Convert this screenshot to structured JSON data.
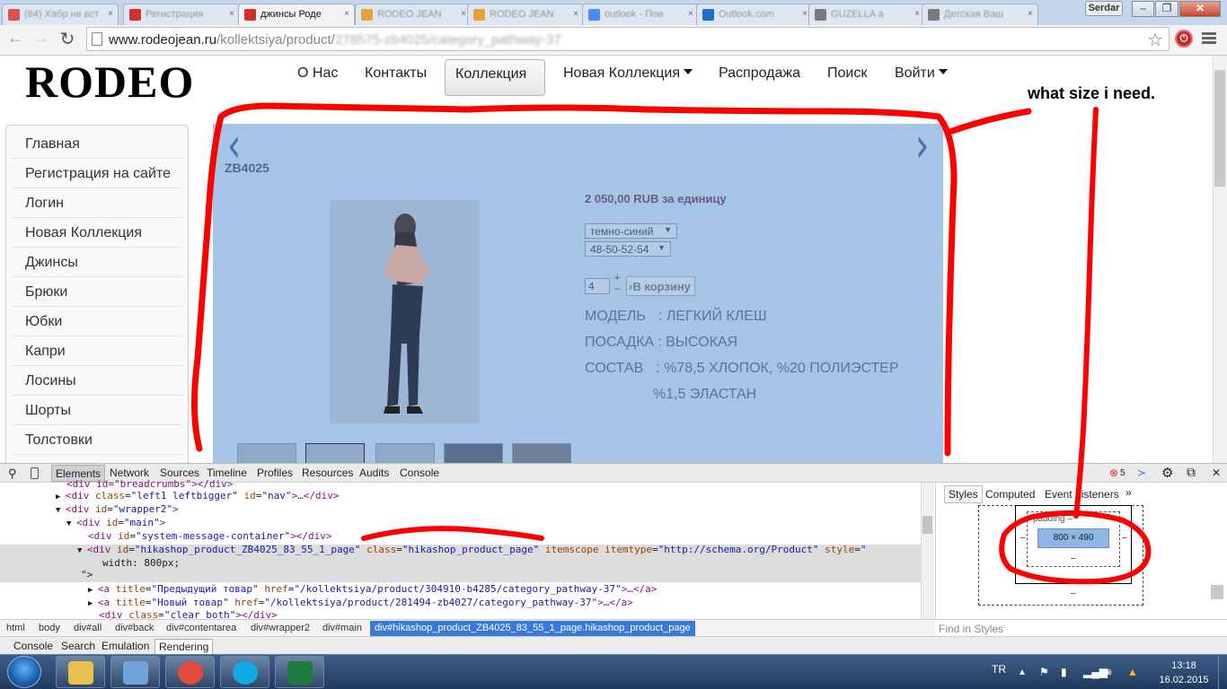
{
  "browser": {
    "tabs": [
      {
        "label": "(84) Хабр не вст",
        "favicon_color": "#d9534f",
        "active": false
      },
      {
        "label": "Регистрация",
        "favicon_color": "#d32f2f",
        "active": false
      },
      {
        "label": "джинсы Роде",
        "favicon_color": "#d32f2f",
        "active": true
      },
      {
        "label": "RODEO JEAN",
        "favicon_color": "#e5a23c",
        "active": false
      },
      {
        "label": "RODEO JEAN",
        "favicon_color": "#e5a23c",
        "active": false
      },
      {
        "label": "outlook - Пои",
        "favicon_color": "#4a8af4",
        "active": false
      },
      {
        "label": "Outlook.com",
        "favicon_color": "#1d6ec5",
        "active": false
      },
      {
        "label": "GUZELLA a",
        "favicon_color": "#7a7a7a",
        "active": false
      },
      {
        "label": "Детская Ваш",
        "favicon_color": "#7a7a7a",
        "active": false
      }
    ],
    "user_badge": "Serdar",
    "url_domain": "www.rodeojean.ru",
    "url_path": "/kollektsiya/product/",
    "url_blurred": "278575-zb4025/category_pathway-37"
  },
  "site": {
    "logo": "RODEO",
    "nav": {
      "about": "О Нас",
      "contacts": "Контакты",
      "collection": "Коллекция",
      "new_collection": "Новая Коллекция",
      "sale": "Распродажа",
      "search": "Поиск",
      "login": "Войти"
    },
    "sidebar": [
      "Главная",
      "Регистрация на сайте",
      "Логин",
      "Новая Коллекция",
      "Джинсы",
      "Брюки",
      "Юбки",
      "Капри",
      "Лосины",
      "Шорты",
      "Толстовки"
    ]
  },
  "product": {
    "code": "ZB4025",
    "price": "2 050,00 RUB за единицу",
    "color_select": "темно-синий",
    "size_select": "48-50-52-54",
    "quantity": "4",
    "qty_plus": "+",
    "qty_minus": "–",
    "add_to_cart": "›В корзину",
    "model_label": "МОДЕЛЬ",
    "model_value": ": ЛЕГКИЙ КЛЕШ",
    "fit_label": "ПОСАДКА",
    "fit_value": ": ВЫСОКАЯ",
    "composition_label": "СОСТАВ",
    "composition_value": ": %78,5 ХЛОПОК, %20 ПОЛИЭСТЕР",
    "composition_value2": "%1,5 ЭЛАСТАН",
    "overlay_color": "#a6c4e6"
  },
  "devtools": {
    "tabs": [
      "Elements",
      "Network",
      "Sources",
      "Timeline",
      "Profiles",
      "Resources",
      "Audits",
      "Console"
    ],
    "error_count": "5",
    "dom_lines": [
      {
        "text_tag": "<div id=\"breadcrumbs\"></div>"
      },
      {
        "tag1": "<div ",
        "attr1": "class",
        "val1": "\"left1 leftbigger\"",
        "attr2": "id",
        "val2": "\"nav\"",
        "tail": ">…</div>"
      },
      {
        "tag1": "<div ",
        "attr1": "id",
        "val1": "\"wrapper2\"",
        "tail": ">"
      },
      {
        "tag1": "<div ",
        "attr1": "id",
        "val1": "\"main\"",
        "tail": ">"
      },
      {
        "tag1": "<div ",
        "attr1": "id",
        "val1": "\"system-message-container\"",
        "tail": "></div>"
      },
      {
        "tag1": "<div ",
        "attr1": "id",
        "val1": "\"hikashop_product_ZB4025_83_55_1_page\"",
        "attr2": "class",
        "val2": "\"hikashop_product_page\"",
        "attr3": "itemscope itemtype",
        "val3": "\"http://schema.org/Product\"",
        "attr4": "style",
        "val4": "\""
      },
      {
        "cont": "width: 800px;"
      },
      {
        "cont": "\">"
      },
      {
        "tag1": "<a ",
        "attr1": "title",
        "val1": "\"Предыдущий товар\"",
        "attr2": "href",
        "val2": "\"/kollektsiya/product/304910-b4285/category_pathway-37\"",
        "tail": ">…</a>"
      },
      {
        "tag1": "<a ",
        "attr1": "title",
        "val1": "\"Новый товар\"",
        "attr2": "href",
        "val2": "\"/kollektsiya/product/281494-zb4027/category_pathway-37\"",
        "tail": ">…</a>"
      },
      {
        "tag1": "<div ",
        "attr1": "class",
        "val1": "\"clear_both\"",
        "tail": "></div>"
      }
    ],
    "styles_tabs": {
      "styles": "Styles",
      "computed": "Computed",
      "event_listeners": "Event Listeners",
      "more": "»"
    },
    "box_padding_label": "padding –",
    "box_content": "800 × 490",
    "box_dash": "–",
    "find_in_styles": "Find in Styles",
    "breadcrumbs": [
      "html",
      "body",
      "div#all",
      "div#back",
      "div#contentarea",
      "div#wrapper2",
      "div#main",
      "div#hikashop_product_ZB4025_83_55_1_page.hikashop_product_page"
    ],
    "drawer_tabs": [
      "Console",
      "Search",
      "Emulation",
      "Rendering"
    ]
  },
  "taskbar": {
    "language": "TR",
    "time": "13:18",
    "date": "16.02.2015",
    "apps": [
      {
        "name": "explorer",
        "color": "#e8c04a"
      },
      {
        "name": "remote-desktop",
        "color": "#6ea4d8"
      },
      {
        "name": "chrome",
        "color": "#e04b3a"
      },
      {
        "name": "skype",
        "color": "#11a9e6"
      },
      {
        "name": "excel",
        "color": "#1f7a3d"
      }
    ]
  },
  "annotation": {
    "note": "what size i need.",
    "color": "#ff0000"
  }
}
